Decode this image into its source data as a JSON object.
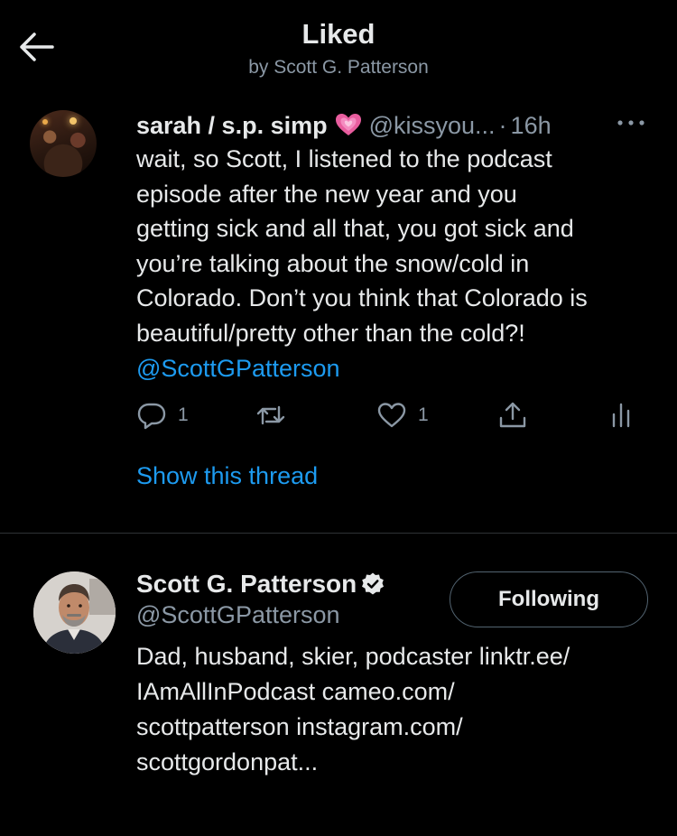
{
  "header": {
    "title": "Liked",
    "subtitle": "by Scott G. Patterson"
  },
  "tweet": {
    "author_name": "sarah / s.p. simp",
    "emoji": "growing-heart",
    "handle": "@kissyou...",
    "separator": "·",
    "time": "16h",
    "body_lines": [
      "wait, so Scott, I listened to the podcast",
      "episode after the new year and you",
      "getting sick and all that, you got sick and",
      "you’re talking about the snow/cold in",
      "Colorado. Don’t you think that Colorado is",
      "beautiful/pretty other than the cold?!"
    ],
    "mention": "@ScottGPatterson",
    "reply_count": "1",
    "retweet_count": "",
    "like_count": "1",
    "show_thread": "Show this thread"
  },
  "user": {
    "name": "Scott G. Patterson",
    "handle": "@ScottGPatterson",
    "follow_label": "Following",
    "bio_lines": [
      "Dad, husband, skier, podcaster linktr.ee/",
      "IAmAllInPodcast cameo.com/",
      "scottpatterson instagram.com/",
      "scottgordonpat..."
    ]
  },
  "colors": {
    "background": "#000000",
    "text": "#e7e9ea",
    "secondary": "#8b98a5",
    "accent": "#1d9bf0",
    "divider": "#2f3336"
  },
  "icons": [
    "back-arrow-icon",
    "growing-heart-emoji",
    "more-icon",
    "reply-icon",
    "retweet-icon",
    "like-icon",
    "share-icon",
    "analytics-icon",
    "verified-icon"
  ]
}
